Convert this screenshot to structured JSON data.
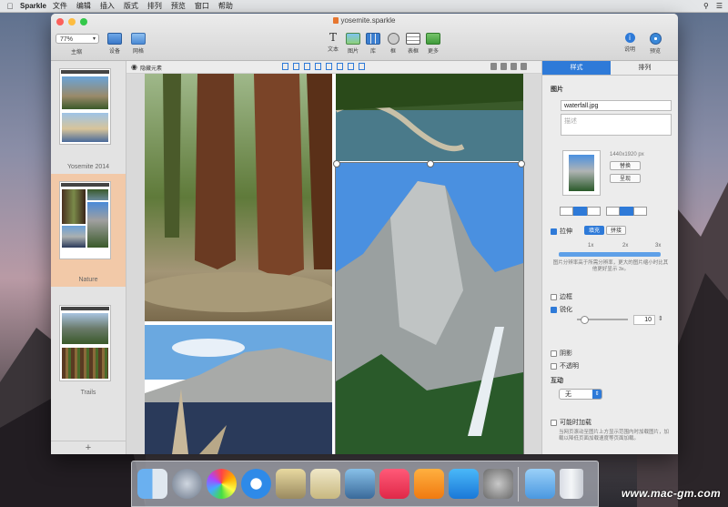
{
  "menubar": {
    "app": "Sparkle",
    "items": [
      "文件",
      "编辑",
      "插入",
      "版式",
      "排列",
      "预览",
      "窗口",
      "帮助"
    ]
  },
  "window": {
    "title": "yosemite.sparkle"
  },
  "toolbar": {
    "zoom": "77%",
    "zoom_label": "主缩",
    "left_buttons": [
      {
        "label": "设备",
        "icon": "device-icon"
      },
      {
        "label": "网格",
        "icon": "grid-icon"
      }
    ],
    "center_buttons": [
      {
        "label": "文本",
        "icon": "text-icon"
      },
      {
        "label": "图片",
        "icon": "image-icon"
      },
      {
        "label": "库",
        "icon": "library-icon"
      },
      {
        "label": "框",
        "icon": "box-icon"
      },
      {
        "label": "表框",
        "icon": "table-icon"
      },
      {
        "label": "更多",
        "icon": "more-icon"
      }
    ],
    "right_buttons": [
      {
        "label": "说明",
        "icon": "info-icon"
      },
      {
        "label": "预览",
        "icon": "preview-icon"
      }
    ]
  },
  "sidebar": {
    "pages": [
      {
        "label": "Yosemite 2014"
      },
      {
        "label": "Nature"
      },
      {
        "label": "Trails"
      }
    ],
    "add": "+"
  },
  "canvas": {
    "hide_label": "隐藏元素"
  },
  "inspector": {
    "tabs": [
      "样式",
      "排列"
    ],
    "section_image": "图片",
    "filename": "waterfall.jpg",
    "desc_placeholder": "描述",
    "dimensions": "1440x1920 px",
    "replace_btn": "替换",
    "show_btn": "呈现",
    "stretch_label": "拉伸",
    "fill_btn": "填充",
    "tile_btn": "拼接",
    "scale_ticks": [
      "1x",
      "2x",
      "3x"
    ],
    "scale_note": "图片分辨率高于所需分辨率，更大的图片缩小时比其他更好显示 3x。",
    "border": "边框",
    "round": "锐化",
    "round_value": "10",
    "shadow": "阴影",
    "opacity": "不透明",
    "interaction": "互动",
    "interaction_value": "无",
    "lazy_load": "可能时加载",
    "lazy_note": "当网页滚动至图片上方显示范围内时加载图片，加载以降低页面加载速度等页面加载。"
  },
  "watermark": "www.mac-gm.com",
  "colors": {
    "accent": "#2e7ad8",
    "selected_page": "#f2c9a8"
  }
}
